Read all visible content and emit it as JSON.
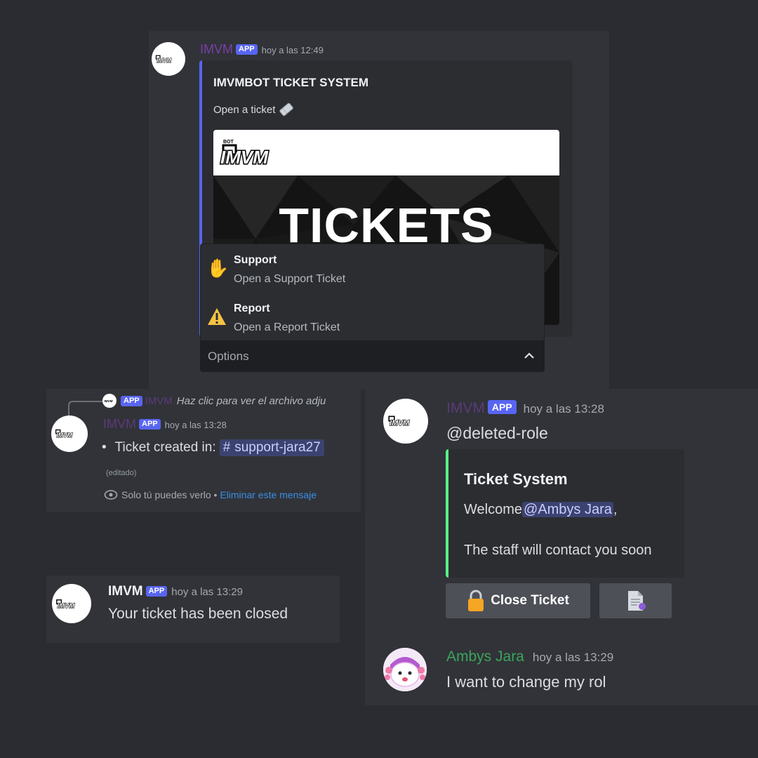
{
  "panel1": {
    "username": "IMVM",
    "badge": "APP",
    "timestamp": "hoy a las 12:49",
    "embed": {
      "title": "IMVMBOT TICKET SYSTEM",
      "description": "Open a ticket",
      "description_icon": "ticket-icon",
      "banner_logo": "IMVM",
      "banner_text": "TICKETS",
      "accent": "#5865f2"
    },
    "dropdown": {
      "options": [
        {
          "label": "Support",
          "description": "Open a Support Ticket",
          "icon": "waving-hand-icon"
        },
        {
          "label": "Report",
          "description": "Open a Report Ticket",
          "icon": "warning-icon"
        }
      ],
      "placeholder": "Options"
    }
  },
  "panel2": {
    "reply": {
      "badge": "APP",
      "username": "IMVM",
      "text": "Haz clic para ver el archivo adju"
    },
    "username": "IMVM",
    "badge": "APP",
    "timestamp": "hoy a las 13:28",
    "bullet_prefix": "Ticket created in:",
    "channel": "support-jara27",
    "edited": "(editado)",
    "ephemeral_text": "Solo tú puedes verlo",
    "ephemeral_sep": " • ",
    "ephemeral_link": "Eliminar este mensaje"
  },
  "panel3": {
    "username": "IMVM",
    "badge": "APP",
    "timestamp": "hoy a las 13:29",
    "text": "Your ticket has been closed"
  },
  "panel4": {
    "username": "IMVM",
    "badge": "APP",
    "timestamp": "hoy a las 13:28",
    "mention_text": "@deleted-role",
    "embed": {
      "title": "Ticket System",
      "welcome": "Welcome",
      "user_mention": "@Ambys Jara",
      "comma": ",",
      "line2": "The staff will contact you soon",
      "accent": "#57f287"
    },
    "close_button": "Close Ticket",
    "close_icon": "lock-icon",
    "transcript_icon": "document-icon",
    "user_message": {
      "username": "Ambys Jara",
      "timestamp": "hoy a las 13:29",
      "text": "I want to change my rol"
    }
  }
}
